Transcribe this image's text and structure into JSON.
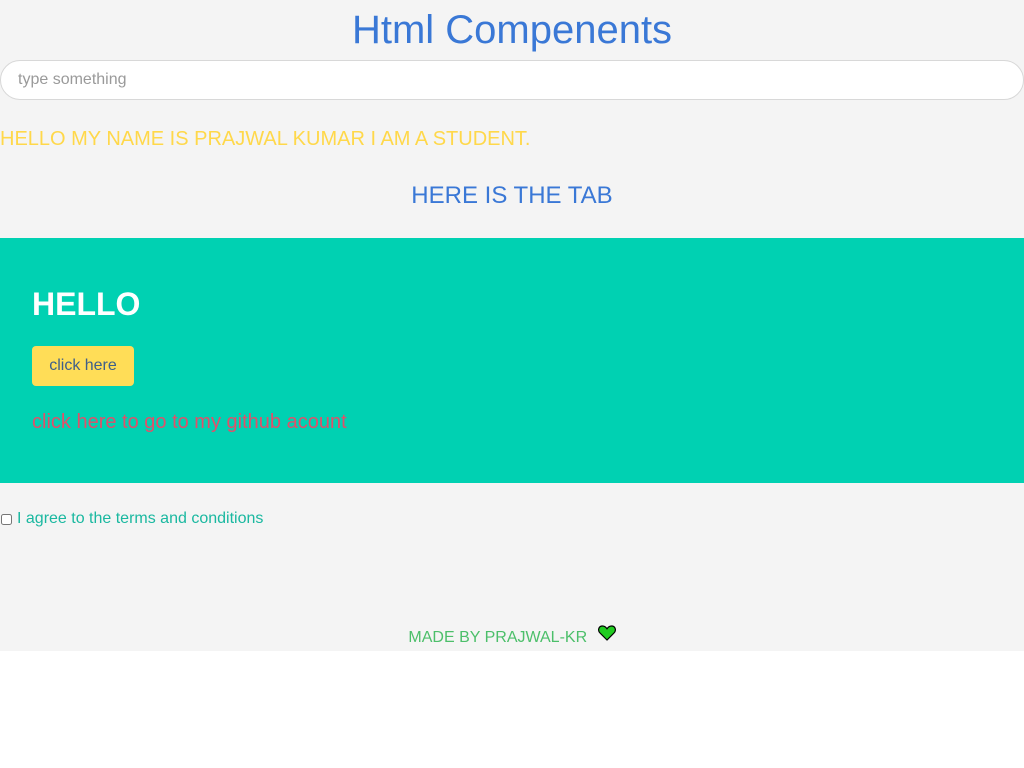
{
  "header": {
    "title": "Html Compenents"
  },
  "search": {
    "placeholder": "type something",
    "value": ""
  },
  "intro": {
    "text": "HELLO MY NAME IS PRAJWAL KUMAR I AM A STUDENT."
  },
  "tab": {
    "heading": "HERE IS THE TAB"
  },
  "hero": {
    "title": "HELLO",
    "button_label": "click here",
    "link_text": "click here to go to my github acount"
  },
  "terms": {
    "label": "I agree to the terms and conditions",
    "checked": false
  },
  "footer": {
    "text": "MADE BY PRAJWAL-KR",
    "icon": "heart-icon"
  },
  "colors": {
    "title": "#3a78d6",
    "intro": "#ffd84a",
    "hero_bg": "#00d1b2",
    "button_bg": "#ffdd57",
    "link": "#e0506a",
    "terms": "#1ab8a0",
    "footer": "#4cbf6a",
    "heart": "#22cc22"
  }
}
